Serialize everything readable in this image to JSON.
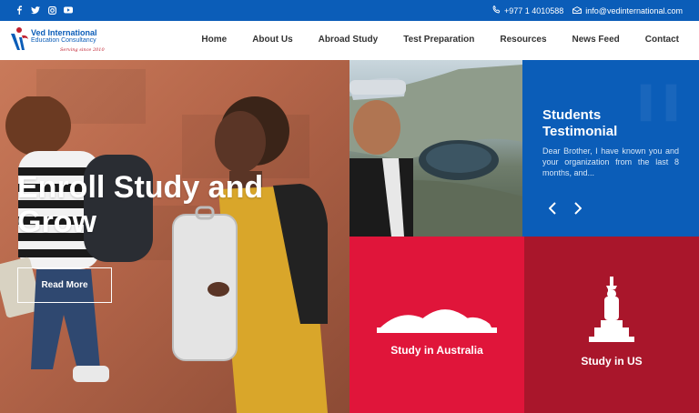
{
  "social_icons": [
    "facebook-icon",
    "twitter-icon",
    "instagram-icon",
    "youtube-icon"
  ],
  "contact": {
    "phone": "+977 1 4010588",
    "email": "info@vedinternational.com"
  },
  "logo": {
    "name": "Ved International",
    "subtitle": "Education Consultancy",
    "tagline": "Serving since 2010"
  },
  "nav": {
    "items": [
      "Home",
      "About Us",
      "Abroad Study",
      "Test Preparation",
      "Resources",
      "News Feed",
      "Contact"
    ]
  },
  "hero": {
    "title": "Enroll Study and Grow",
    "button": "Read More"
  },
  "testimonial": {
    "title": "Students Testimonial",
    "text": "Dear Brother, I have known you and your organization from the last 8 months, and..."
  },
  "study": {
    "australia": "Study in Australia",
    "us": "Study in US"
  },
  "colors": {
    "brand_blue": "#0b5db8",
    "red": "#e0153a",
    "dark_red": "#a9162b"
  }
}
